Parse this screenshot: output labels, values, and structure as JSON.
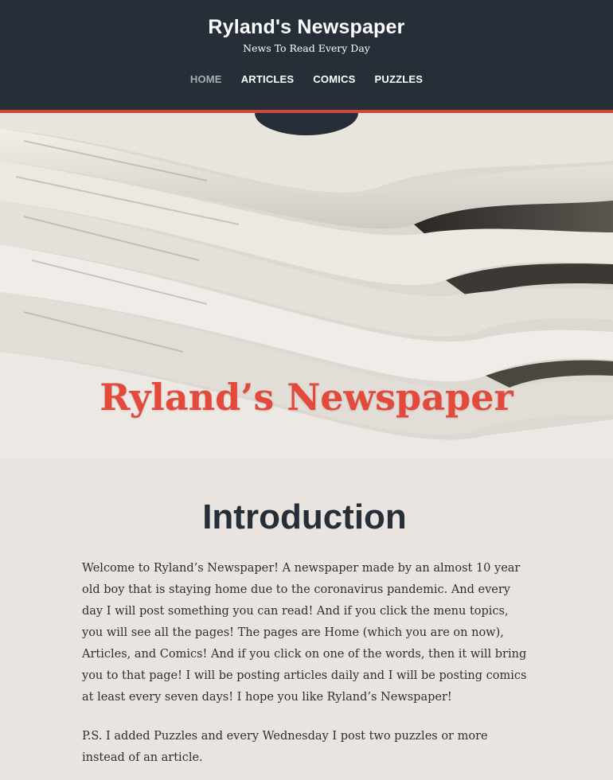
{
  "header": {
    "title": "Ryland's Newspaper",
    "tagline": "News To Read Every Day",
    "nav": [
      "HOME",
      "ARTICLES",
      "COMICS",
      "PUZZLES"
    ],
    "active_nav": "HOME"
  },
  "hero": {
    "title": "Ryland’s Newspaper"
  },
  "main": {
    "heading": "Introduction",
    "paragraphs": [
      "Welcome to Ryland’s Newspaper! A newspaper made by an almost 10 year old boy that is staying home due to the coronavirus pandemic. And every day I will post something you can read! And if you click the menu topics, you will see all the pages! The pages are Home (which you are on now), Articles, and Comics! And if you click on one of the words, then it will bring you to that page! I will be posting articles daily and I will be posting comics at least every seven days! I hope you like Ryland’s Newspaper!",
      "P.S. I added Puzzles and every Wednesday I post two puzzles or more instead of an article."
    ]
  },
  "colors": {
    "header_bg": "#262e38",
    "accent": "#d0483d",
    "hero_title": "#e34a3c",
    "page_bg": "#e9e4df"
  }
}
